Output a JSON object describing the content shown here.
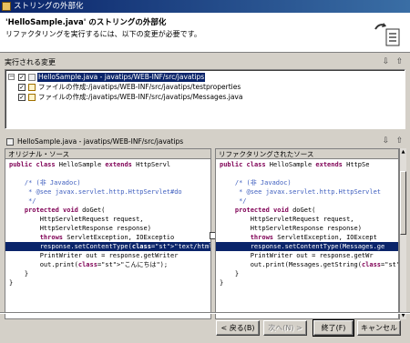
{
  "window": {
    "title": "ストリングの外部化"
  },
  "header": {
    "title": "'HelloSample.java' のストリングの外部化",
    "subtitle": "リファクタリングを実行するには、以下の変更が必要です。"
  },
  "changes": {
    "label": "実行される変更",
    "items": [
      {
        "label": "HelloSample.java - javatips/WEB-INF/src/javatips",
        "selected": true
      },
      {
        "label": "ファイルの作成:/javatips/WEB-INF/src/javatips/testproperties",
        "selected": false
      },
      {
        "label": "ファイルの作成:/javatips/WEB-INF/src/javatips/Messages.java",
        "selected": false
      }
    ]
  },
  "compare": {
    "title": "HelloSample.java - javatips/WEB-INF/src/javatips",
    "left_label": "オリジナル・ソース",
    "right_label": "リファクタリングされたソース",
    "left_lines": [
      "public class HelloSample extends HttpServl",
      "",
      "    /* (非 Javadoc)",
      "     * @see javax.servlet.http.HttpServlet#do",
      "     */",
      "    protected void doGet(",
      "        HttpServletRequest request,",
      "        HttpServletResponse response)",
      "        throws ServletException, IOExceptio",
      "        response.setContentType(\"text/html;ch",
      "        PrintWriter out = response.getWriter",
      "        out.print(\"こんにちは\");",
      "    }",
      "}"
    ],
    "right_lines": [
      "public class HelloSample extends HttpSe",
      "",
      "    /* (非 Javadoc)",
      "     * @see javax.servlet.http.HttpServlet",
      "     */",
      "    protected void doGet(",
      "        HttpServletRequest request,",
      "        HttpServletResponse response)",
      "        throws ServletException, IOExcept",
      "        response.setContentType(Messages.ge",
      "        PrintWriter out = response.getWr",
      "        out.print(Messages.getString(\"He",
      "    }",
      "}"
    ]
  },
  "buttons": {
    "back": "< 戻る(B)",
    "next": "次へ(N) >",
    "finish": "終了(F)",
    "cancel": "キャンセル"
  },
  "colors": {
    "selection": "#0a246a",
    "keyword": "#7f0055",
    "string": "#2a00ff",
    "comment": "#3f5fbf"
  }
}
